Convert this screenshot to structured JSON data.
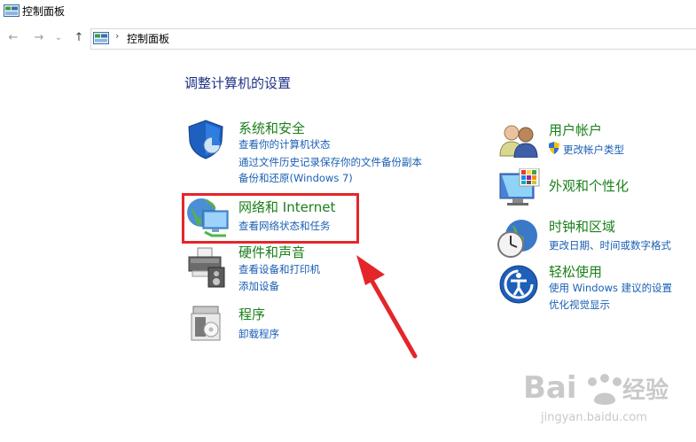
{
  "window": {
    "title": "控制面板"
  },
  "nav": {
    "back_glyph": "←",
    "forward_glyph": "→",
    "recent_glyph": "⌄",
    "up_glyph": "↑",
    "separator": "›",
    "address": "控制面板"
  },
  "page": {
    "title": "调整计算机的设置"
  },
  "categories_left": [
    {
      "icon": "shield-icon",
      "title": "系统和安全",
      "links": [
        "查看你的计算机状态",
        "通过文件历史记录保存你的文件备份副本",
        "备份和还原(Windows 7)"
      ]
    },
    {
      "icon": "network-icon",
      "title": "网络和 Internet",
      "links": [
        "查看网络状态和任务"
      ]
    },
    {
      "icon": "printer-icon",
      "title": "硬件和声音",
      "links": [
        "查看设备和打印机",
        "添加设备"
      ]
    },
    {
      "icon": "programs-icon",
      "title": "程序",
      "links": [
        "卸载程序"
      ]
    }
  ],
  "categories_right": [
    {
      "icon": "users-icon",
      "title": "用户帐户",
      "links": [
        "更改帐户类型"
      ]
    },
    {
      "icon": "appearance-icon",
      "title": "外观和个性化",
      "links": []
    },
    {
      "icon": "clock-globe-icon",
      "title": "时钟和区域",
      "links": [
        "更改日期、时间或数字格式"
      ]
    },
    {
      "icon": "ease-of-access-icon",
      "title": "轻松使用",
      "links": [
        "使用 Windows 建议的设置",
        "优化视觉显示"
      ]
    }
  ],
  "annotation": {
    "color": "#e4262a"
  },
  "watermark": {
    "brand": "Bai",
    "brand2": "经验",
    "url": "jingyan.baidu.com"
  },
  "colors": {
    "category_title": "#1a7f1a",
    "link": "#1a5fb4",
    "page_title": "#1e3287"
  }
}
